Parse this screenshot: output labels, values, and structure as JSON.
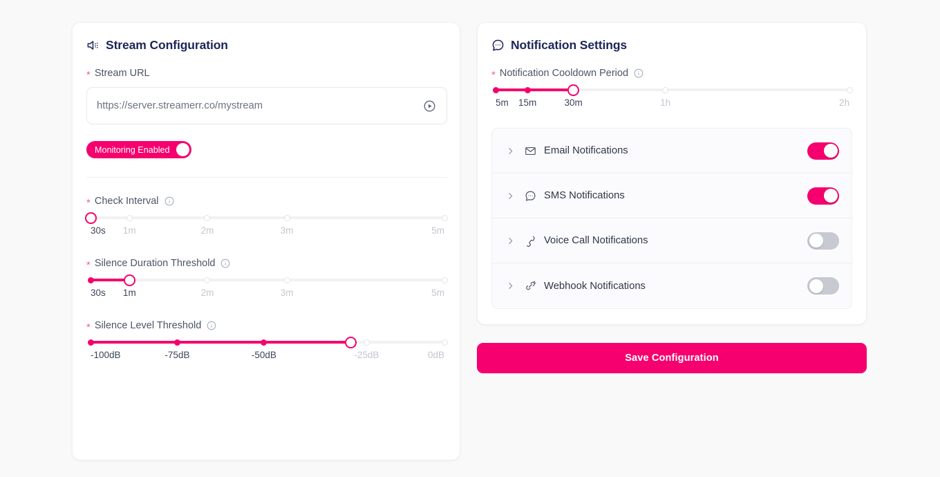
{
  "stream_panel": {
    "title": "Stream Configuration",
    "title_icon": "speaker-sound-icon",
    "url_field": {
      "label": "Stream URL",
      "required_marker": "*",
      "value": "https://server.streamerr.co/mystream",
      "placeholder": "https://server.streamerr.co/mystream",
      "action_icon": "play-circle-icon"
    },
    "monitoring_toggle": {
      "label": "Monitoring Enabled",
      "state": "on"
    },
    "check_interval": {
      "label": "Check Interval",
      "required_marker": "*",
      "has_info": true,
      "value": "30s",
      "percent": 0,
      "ticks": [
        {
          "label": "30s",
          "percent": 0,
          "active": true
        },
        {
          "label": "1m",
          "percent": 11,
          "active": false
        },
        {
          "label": "2m",
          "percent": 33,
          "active": false
        },
        {
          "label": "3m",
          "percent": 55.5,
          "active": false
        },
        {
          "label": "5m",
          "percent": 100,
          "active": false
        }
      ]
    },
    "silence_duration": {
      "label": "Silence Duration Threshold",
      "required_marker": "*",
      "has_info": true,
      "value": "1m",
      "percent": 11,
      "ticks": [
        {
          "label": "30s",
          "percent": 0,
          "active": true
        },
        {
          "label": "1m",
          "percent": 11,
          "active": true
        },
        {
          "label": "2m",
          "percent": 33,
          "active": false
        },
        {
          "label": "3m",
          "percent": 55.5,
          "active": false
        },
        {
          "label": "5m",
          "percent": 100,
          "active": false
        }
      ]
    },
    "silence_level": {
      "label": "Silence Level Threshold",
      "required_marker": "*",
      "has_info": true,
      "value": "-28dB",
      "percent": 73.5,
      "ticks": [
        {
          "label": "-100dB",
          "percent": 0,
          "active": true
        },
        {
          "label": "-75dB",
          "percent": 24.5,
          "active": true
        },
        {
          "label": "-50dB",
          "percent": 49,
          "active": true
        },
        {
          "label": "-25dB",
          "percent": 78,
          "active": false
        },
        {
          "label": "0dB",
          "percent": 100,
          "active": false
        }
      ]
    }
  },
  "notification_panel": {
    "title": "Notification Settings",
    "title_icon": "message-bubble-icon",
    "cooldown": {
      "label": "Notification Cooldown Period",
      "required_marker": "*",
      "has_info": true,
      "value": "30m",
      "percent": 22,
      "ticks": [
        {
          "label": "5m",
          "percent": 0,
          "active": true
        },
        {
          "label": "15m",
          "percent": 9,
          "active": true
        },
        {
          "label": "30m",
          "percent": 22,
          "active": true
        },
        {
          "label": "1h",
          "percent": 48,
          "active": false
        },
        {
          "label": "2h",
          "percent": 100,
          "active": false
        }
      ]
    },
    "channels": [
      {
        "label": "Email Notifications",
        "icon": "mail-icon",
        "enabled": true
      },
      {
        "label": "SMS Notifications",
        "icon": "message-icon",
        "enabled": true
      },
      {
        "label": "Voice Call Notifications",
        "icon": "phone-icon",
        "enabled": false
      },
      {
        "label": "Webhook Notifications",
        "icon": "link-icon",
        "enabled": false
      }
    ]
  },
  "save_button": {
    "label": "Save Configuration"
  },
  "colors": {
    "accent": "#f5006e",
    "title": "#1b2559",
    "label": "#4a5568",
    "required": "#f0657f",
    "track": "#f2f2f4",
    "switch_off": "#c7cad1",
    "background": "#f9f9fa"
  }
}
